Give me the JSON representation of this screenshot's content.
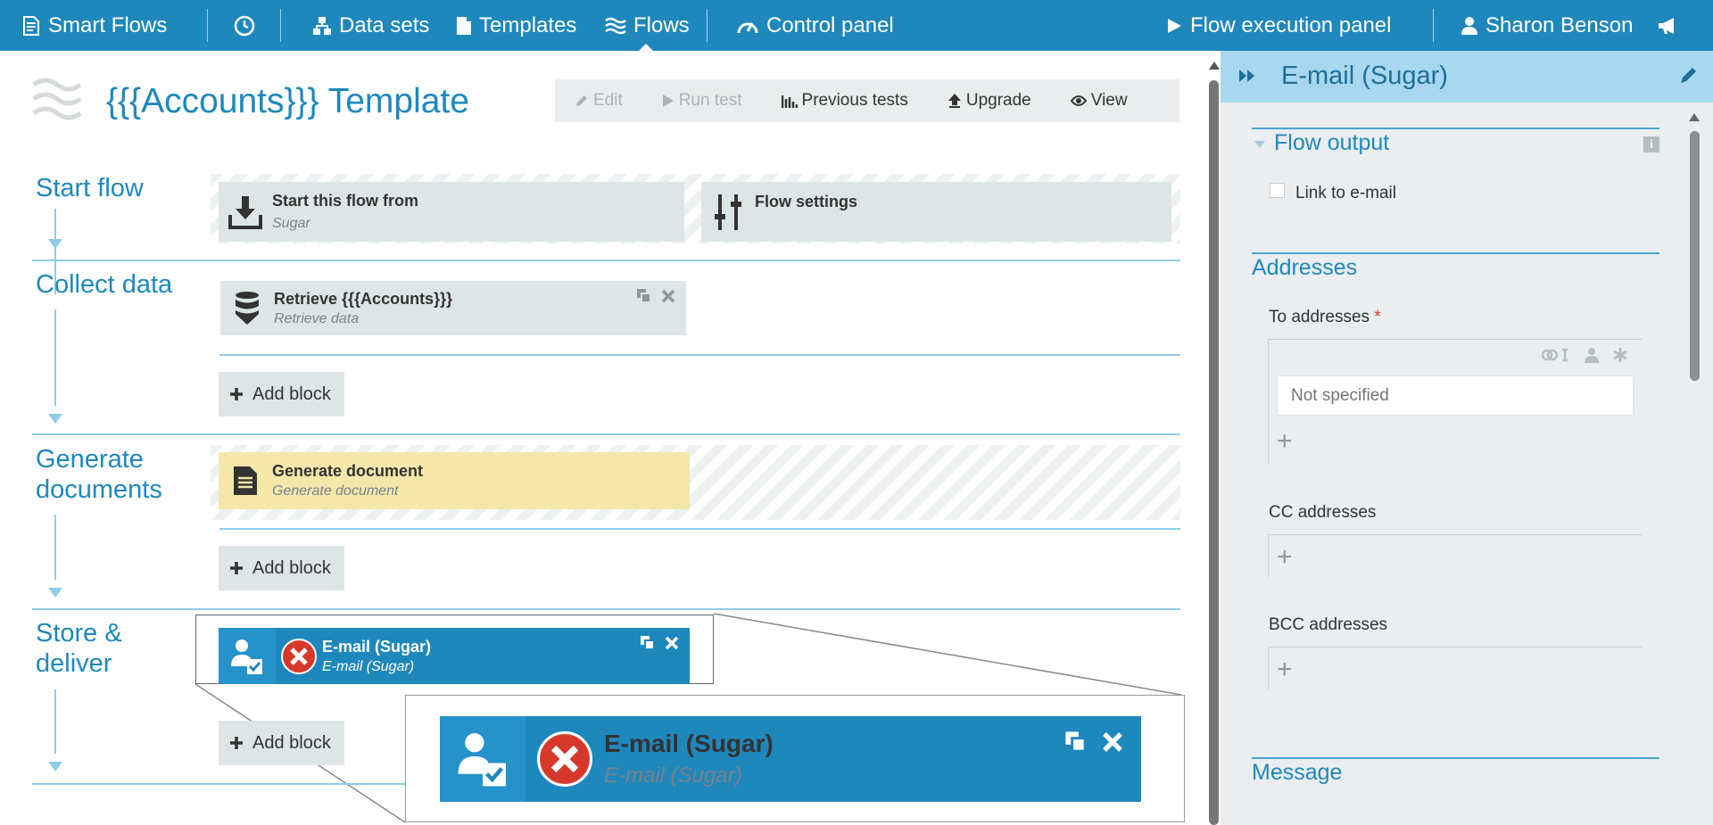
{
  "topbar": {
    "brand": "Smart Flows",
    "nav_datasets": "Data sets",
    "nav_templates": "Templates",
    "nav_flows": "Flows",
    "nav_control": "Control panel",
    "flow_exec": "Flow execution panel",
    "user": "Sharon Benson"
  },
  "page": {
    "title": "{{{Accounts}}} Template"
  },
  "toolbar": {
    "edit": "Edit",
    "run_test": "Run test",
    "previous_tests": "Previous tests",
    "upgrade": "Upgrade",
    "view": "View"
  },
  "stages": {
    "start": "Start flow",
    "collect": "Collect data",
    "generate_1": "Generate",
    "generate_2": "documents",
    "store_1": "Store &",
    "store_2": "deliver"
  },
  "blocks": {
    "start_from_title": "Start this flow from",
    "start_from_sub": "Sugar",
    "flow_settings_title": "Flow settings",
    "retrieve_title": "Retrieve {{{Accounts}}}",
    "retrieve_sub": "Retrieve data",
    "generate_title": "Generate document",
    "generate_sub": "Generate document",
    "email_title": "E-mail (Sugar)",
    "email_sub": "E-mail (Sugar)"
  },
  "add_block": "Add block",
  "panel": {
    "title": "E-mail (Sugar)",
    "flow_output": "Flow output",
    "link_to_email": "Link to e-mail",
    "addresses": "Addresses",
    "to_addresses": "To addresses",
    "required_mark": "*",
    "to_placeholder": "Not specified",
    "cc_addresses": "CC addresses",
    "bcc_addresses": "BCC addresses",
    "message": "Message"
  },
  "colors": {
    "brand": "#1e88bd",
    "panel_header": "#a7d8ef",
    "generate_block": "#f3e7aa",
    "error_red": "#d6392b"
  }
}
